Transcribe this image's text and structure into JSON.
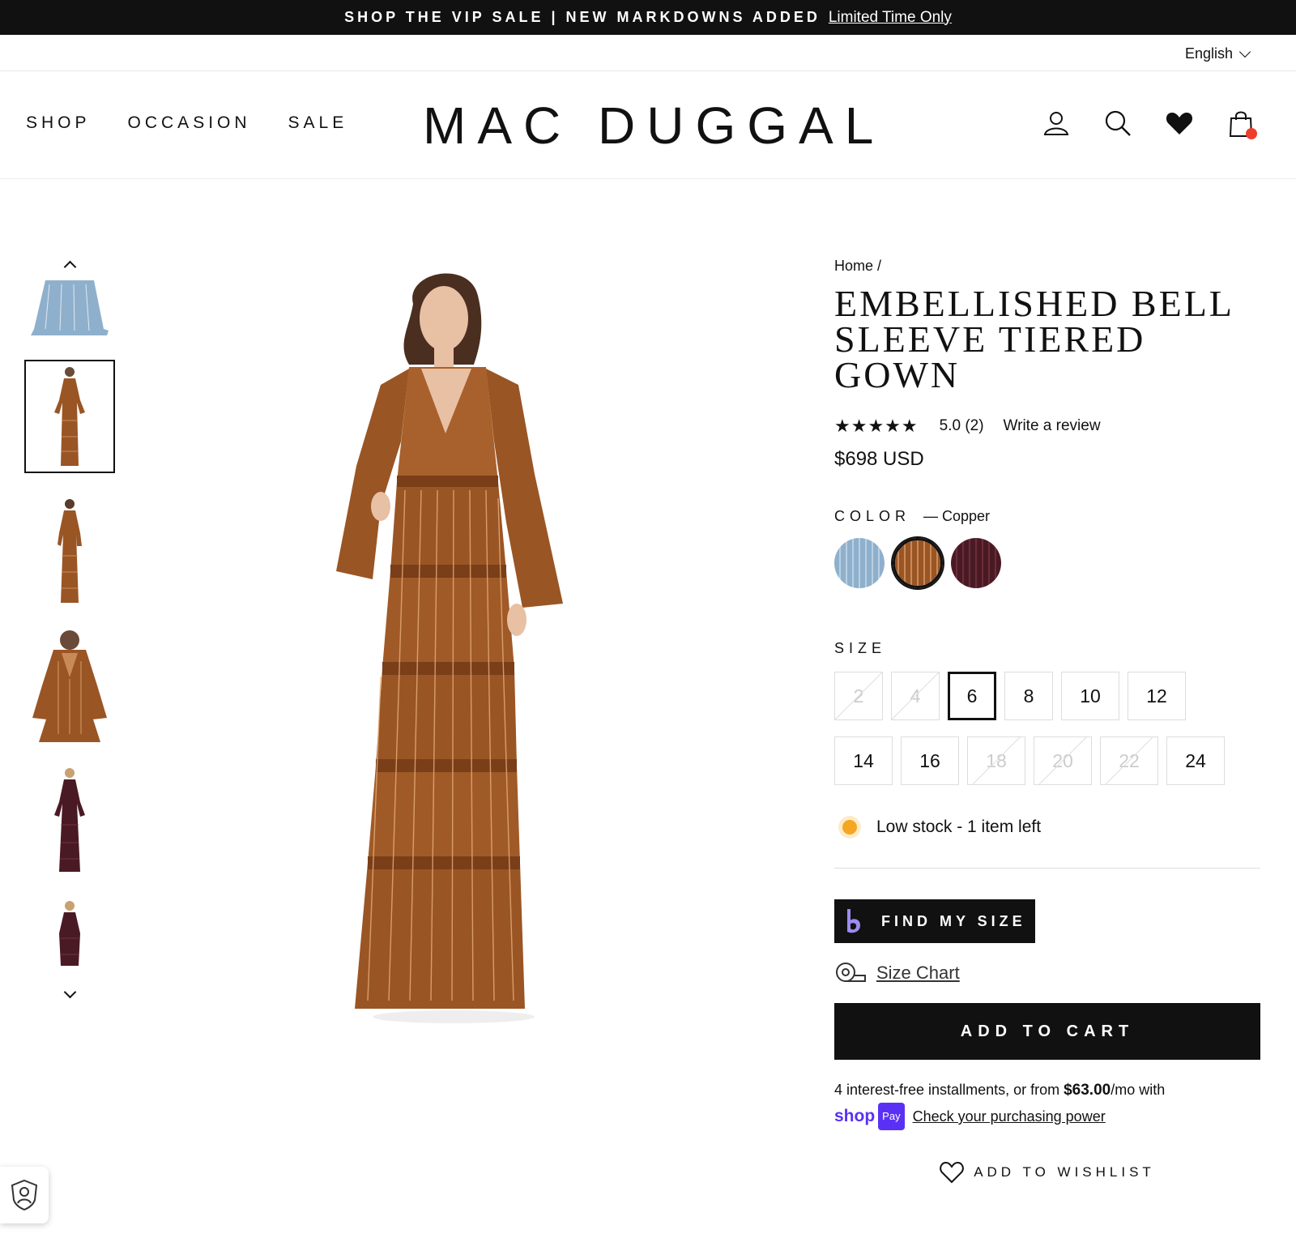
{
  "announcement": {
    "text": "SHOP THE VIP SALE | NEW MARKDOWNS ADDED",
    "link": "Limited Time Only"
  },
  "language": "English",
  "nav": [
    {
      "label": "SHOP"
    },
    {
      "label": "OCCASION"
    },
    {
      "label": "SALE"
    }
  ],
  "brand": "MAC DUGGAL",
  "header_icons": [
    "account-icon",
    "search-icon",
    "wishlist-heart-icon",
    "cart-icon"
  ],
  "product": {
    "breadcrumb": "Home /",
    "title": "EMBELLISHED BELL SLEEVE TIERED GOWN",
    "stars": "★★★★★",
    "rating": "5.0 (2)",
    "write_review": "Write a review",
    "price": "$698 USD",
    "color_label": "COLOR",
    "color_value": "— Copper",
    "colors": [
      {
        "name": "Blue",
        "hex": "#8fb0cc",
        "selected": false
      },
      {
        "name": "Copper",
        "hex": "#9a5524",
        "selected": true
      },
      {
        "name": "Burgundy",
        "hex": "#4a1a24",
        "selected": false
      }
    ],
    "size_label": "SIZE",
    "sizes": [
      {
        "label": "2",
        "available": false,
        "selected": false
      },
      {
        "label": "4",
        "available": false,
        "selected": false
      },
      {
        "label": "6",
        "available": true,
        "selected": true
      },
      {
        "label": "8",
        "available": true,
        "selected": false
      },
      {
        "label": "10",
        "available": true,
        "selected": false
      },
      {
        "label": "12",
        "available": true,
        "selected": false
      },
      {
        "label": "14",
        "available": true,
        "selected": false
      },
      {
        "label": "16",
        "available": true,
        "selected": false
      },
      {
        "label": "18",
        "available": false,
        "selected": false
      },
      {
        "label": "20",
        "available": false,
        "selected": false
      },
      {
        "label": "22",
        "available": false,
        "selected": false
      },
      {
        "label": "24",
        "available": true,
        "selected": false
      }
    ],
    "stock": "Low stock - 1 item left",
    "find_my_size": "FIND MY SIZE",
    "size_chart": "Size Chart",
    "add_to_cart": "ADD TO CART",
    "installments_pre": "4 interest-free installments, or from ",
    "installments_amount": "$63.00",
    "installments_post": "/mo with",
    "shop_pay": "shop",
    "pay_badge": "Pay",
    "purchasing_power": "Check your purchasing power",
    "add_to_wishlist": "ADD TO WISHLIST"
  },
  "colors": {
    "gown": "#9a5524",
    "accent": "#111111",
    "stock_dot": "#f5a623",
    "shop_pay": "#5a31f4",
    "cart_dot": "#ef3e2c"
  }
}
